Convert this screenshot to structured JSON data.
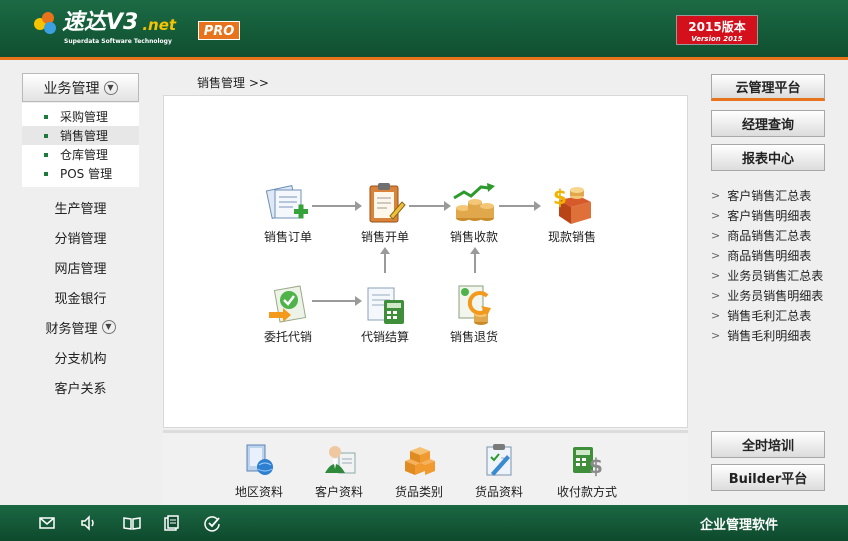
{
  "header": {
    "brand": "速达V3",
    "brand_suffix": ".net",
    "brand_sub": "Superdata Software Technology",
    "edition_badge": "PRO",
    "version_line1": "2015版本",
    "version_line2": "Version 2015"
  },
  "left_menu": {
    "business_label": "业务管理",
    "sub_items": [
      "采购管理",
      "销售管理",
      "仓库管理",
      "POS 管理"
    ],
    "nav_items": [
      "生产管理",
      "分销管理",
      "网店管理",
      "现金银行"
    ],
    "finance_label": "财务管理",
    "nav_items2": [
      "分支机构",
      "客户关系"
    ]
  },
  "breadcrumb": "销售管理  >>",
  "flow": {
    "sales_order": "销售订单",
    "sales_invoice": "销售开单",
    "sales_collection": "销售收款",
    "cash_sales": "现款销售",
    "consignment": "委托代销",
    "consignment_settlement": "代销结算",
    "sales_return": "销售退货"
  },
  "tools": [
    "地区资料",
    "客户资料",
    "货品类别",
    "货品资料",
    "收付款方式"
  ],
  "right_panel": {
    "cloud": "云管理平台",
    "manager_query": "经理查询",
    "report_center": "报表中心",
    "reports": [
      "客户销售汇总表",
      "客户销售明细表",
      "商品销售汇总表",
      "商品销售明细表",
      "业务员销售汇总表",
      "业务员销售明细表",
      "销售毛利汇总表",
      "销售毛利明细表"
    ],
    "training": "全时培训",
    "builder": "Builder平台"
  },
  "footer": {
    "title": "企业管理软件"
  },
  "colors": {
    "header_green": "#1c6b45",
    "accent_orange": "#e8731d",
    "version_red": "#d3101b"
  }
}
